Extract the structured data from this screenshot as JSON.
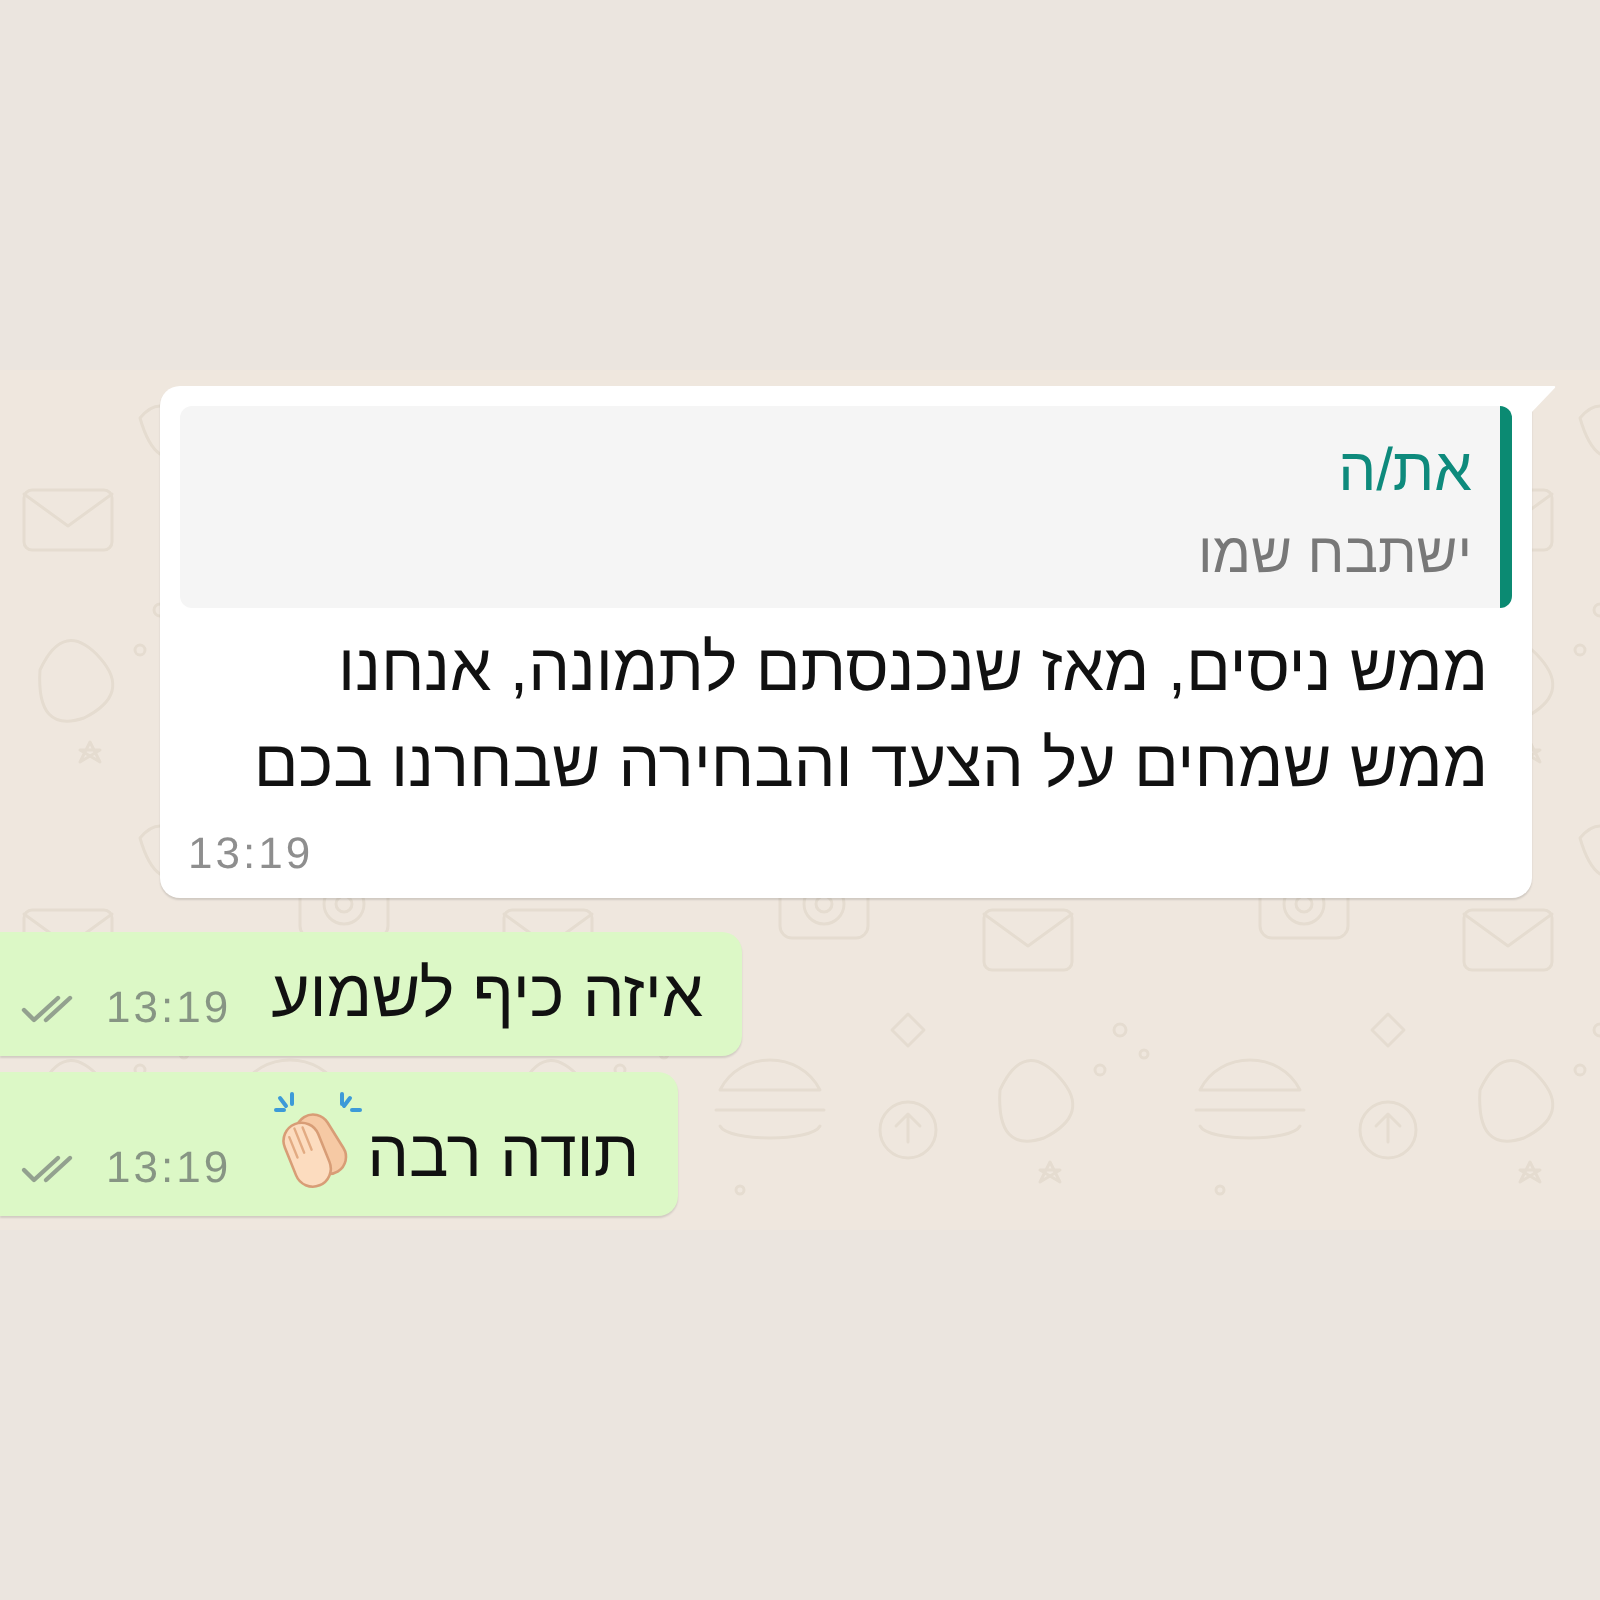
{
  "chat": {
    "incoming": {
      "quote": {
        "author": "את/ה",
        "text": "ישתבח שמו"
      },
      "text": "ממש ניסים, מאז שנכנסתם לתמונה, אנחנו\nממש שמחים על הצעד והבחירה שבחרנו בכם",
      "time": "13:19"
    },
    "outgoing": [
      {
        "kind": "text",
        "text": "איזה כיף לשמוע",
        "time": "13:19",
        "read": false
      },
      {
        "kind": "text_emoji",
        "text": "תודה רבה",
        "time": "13:19",
        "read": false
      }
    ]
  }
}
